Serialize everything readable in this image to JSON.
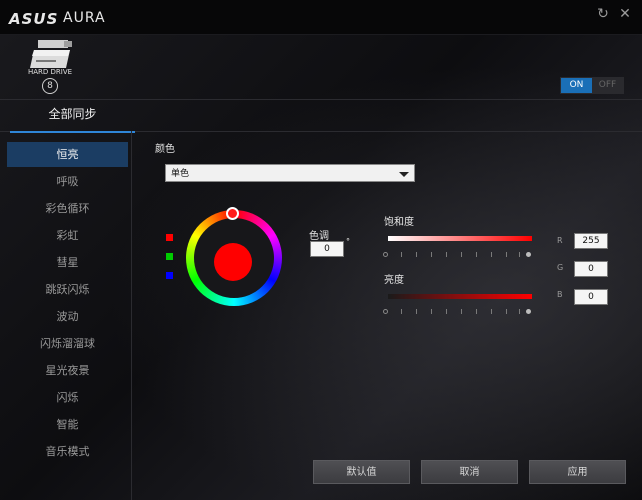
{
  "header": {
    "logo": "ASUS",
    "title": "AURA"
  },
  "device": {
    "label": "HARD DRIVE",
    "badge": "8"
  },
  "power_toggle": {
    "on": "ON",
    "off": "OFF",
    "state": "ON"
  },
  "tab": {
    "label": "全部同步"
  },
  "sidebar": {
    "items": [
      {
        "label": "恒亮",
        "active": true
      },
      {
        "label": "呼吸"
      },
      {
        "label": "彩色循环"
      },
      {
        "label": "彩虹"
      },
      {
        "label": "彗星"
      },
      {
        "label": "跳跃闪烁"
      },
      {
        "label": "波动"
      },
      {
        "label": "闪烁溜溜球"
      },
      {
        "label": "星光夜景"
      },
      {
        "label": "闪烁"
      },
      {
        "label": "智能"
      },
      {
        "label": "音乐模式"
      }
    ]
  },
  "color_section": {
    "label": "颜色",
    "mode": "单色",
    "swatches": [
      "#ff0000",
      "#00cc00",
      "#0000ff"
    ],
    "selected_color": "#ff0000"
  },
  "hue": {
    "label": "色调",
    "value": "0",
    "unit": "°"
  },
  "saturation": {
    "label": "饱和度",
    "level": 1.0
  },
  "brightness": {
    "label": "亮度",
    "level": 1.0
  },
  "rgb": {
    "r_label": "R",
    "r": "255",
    "g_label": "G",
    "g": "0",
    "b_label": "B",
    "b": "0"
  },
  "buttons": {
    "default": "默认值",
    "cancel": "取消",
    "apply": "应用"
  }
}
